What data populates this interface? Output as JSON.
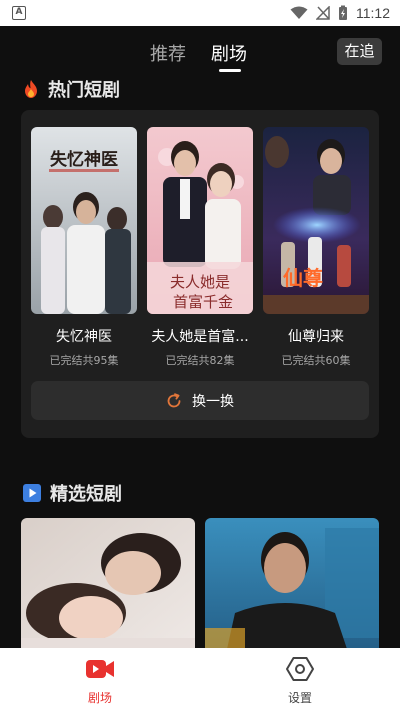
{
  "status_bar": {
    "app_badge": "A",
    "time": "11:12"
  },
  "top_nav": {
    "tabs": [
      {
        "label": "推荐",
        "active": false
      },
      {
        "label": "剧场",
        "active": true
      }
    ],
    "following_button": "在追"
  },
  "hot_section": {
    "title": "热门短剧",
    "dramas": [
      {
        "title": "失忆神医",
        "status": "已完结共95集",
        "poster_text": "失忆神医"
      },
      {
        "title": "夫人她是首富...",
        "status": "已完结共82集",
        "poster_text": "夫人她是首富千金"
      },
      {
        "title": "仙尊归来",
        "status": "已完结共60集",
        "poster_text": "仙尊归来"
      }
    ],
    "refresh_label": "换一换"
  },
  "picks_section": {
    "title": "精选短剧"
  },
  "bottom_nav": {
    "items": [
      {
        "label": "剧场",
        "active": true
      },
      {
        "label": "设置",
        "active": false
      }
    ]
  },
  "colors": {
    "accent": "#e8322f",
    "refresh_icon": "#e2763a",
    "background": "#0f0f0f",
    "card": "#1f1f1f"
  }
}
